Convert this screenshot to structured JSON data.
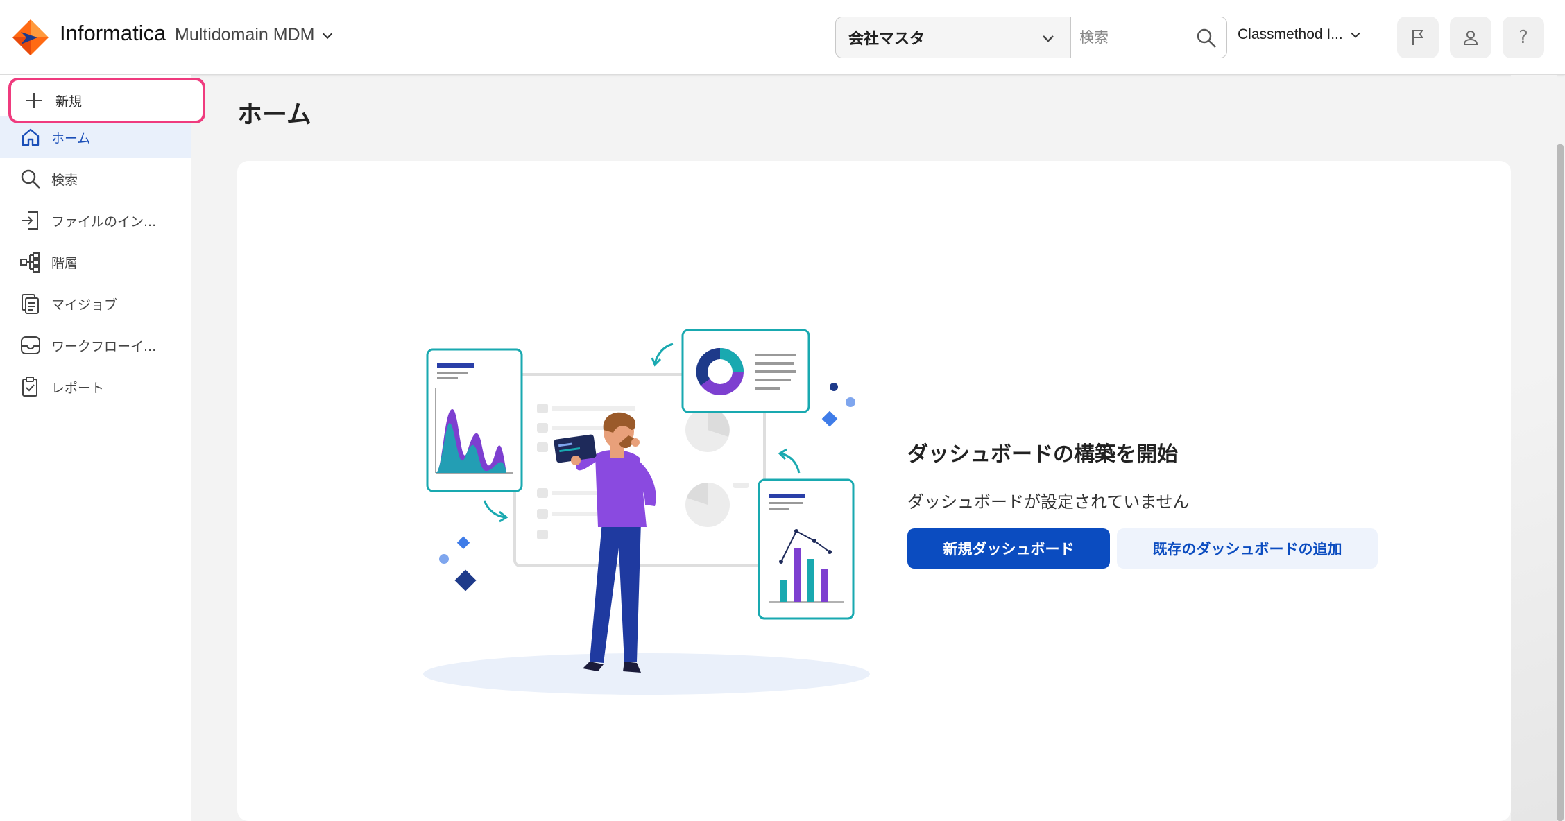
{
  "header": {
    "brand": "Informatica",
    "product": "Multidomain MDM",
    "domain_select": "会社マスタ",
    "search_placeholder": "検索",
    "org": "Classmethod I...",
    "icons": [
      "flag-icon",
      "user-icon",
      "help-icon"
    ],
    "help_glyph": "?"
  },
  "sidebar": {
    "new_label": "新規",
    "items": [
      {
        "label": "ホーム",
        "icon": "home-icon",
        "active": true
      },
      {
        "label": "検索",
        "icon": "search-icon"
      },
      {
        "label": "ファイルのイン...",
        "icon": "file-import-icon"
      },
      {
        "label": "階層",
        "icon": "hierarchy-icon"
      },
      {
        "label": "マイジョブ",
        "icon": "jobs-icon"
      },
      {
        "label": "ワークフローイ...",
        "icon": "inbox-icon"
      },
      {
        "label": "レポート",
        "icon": "report-icon"
      }
    ]
  },
  "main": {
    "title": "ホーム",
    "empty_title": "ダッシュボードの構築を開始",
    "empty_subtitle": "ダッシュボードが設定されていません",
    "primary_button": "新規ダッシュボード",
    "secondary_button": "既存のダッシュボードの追加"
  },
  "colors": {
    "accent": "#0b4cc0",
    "highlight": "#ef3b7e",
    "active_bg": "#e9f0fb",
    "illustration_teal": "#19a9b0",
    "illustration_purple": "#7d3fd0"
  }
}
